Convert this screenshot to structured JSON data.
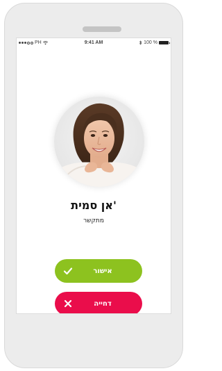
{
  "status_bar": {
    "carrier": "PH",
    "time": "9:41 AM",
    "battery": "100 %"
  },
  "call": {
    "caller_name": "אן סמית'",
    "status": "מתקשר"
  },
  "actions": {
    "accept_label": "אישור",
    "decline_label": "דחייה"
  },
  "colors": {
    "accept": "#8dc21f",
    "decline": "#ea0d4b"
  },
  "icons": {
    "accept": "checkmark-icon",
    "decline": "close-icon"
  }
}
